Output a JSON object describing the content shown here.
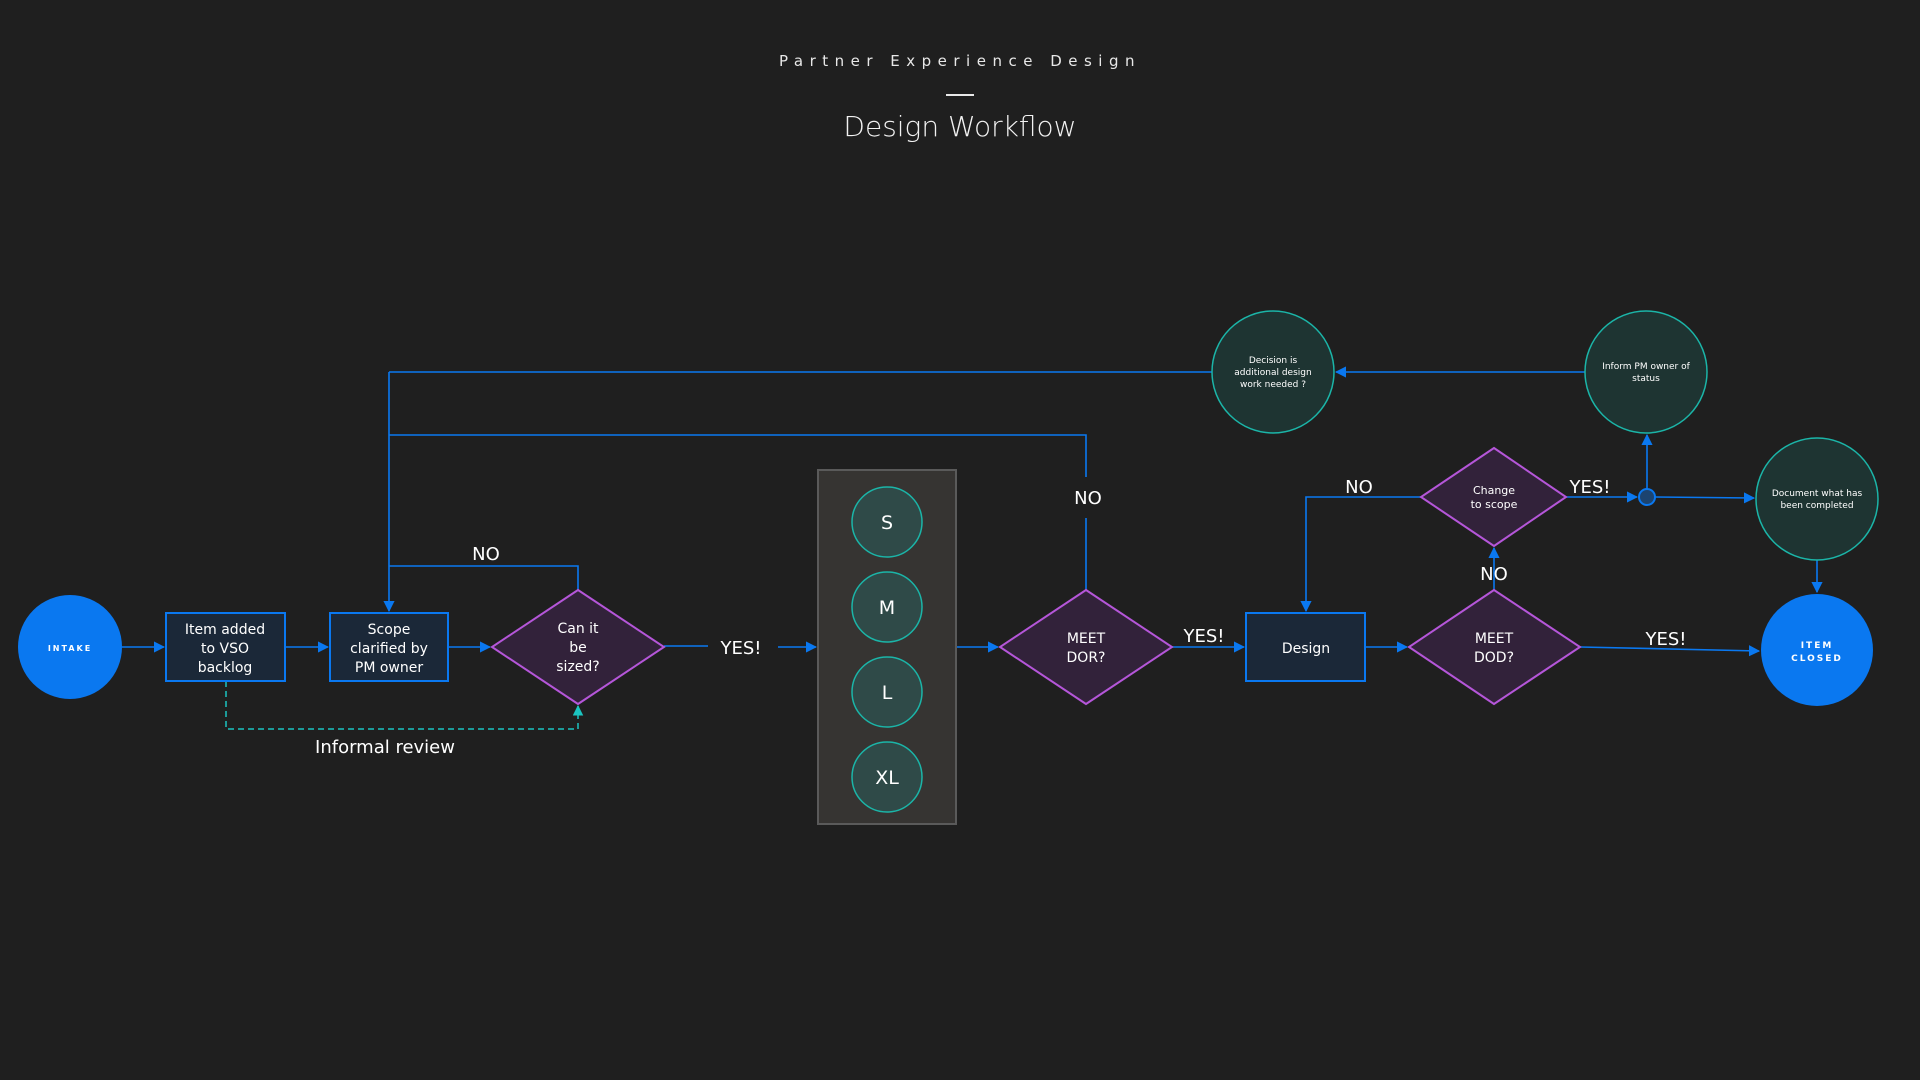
{
  "header": {
    "subtitle": "Partner Experience Design",
    "title": "Design Workflow"
  },
  "colors": {
    "background": "#1f1f1f",
    "connector": "#0a78f0",
    "terminal_fill": "#0a78f0",
    "process_fill": "#1b2838",
    "process_stroke": "#0a78f0",
    "decision_fill": "#32223a",
    "decision_stroke": "#b556d9",
    "action_fill": "#1e3432",
    "action_stroke": "#1bb5a8",
    "size_panel_fill": "#363432",
    "size_panel_stroke": "#5a5a5a",
    "size_circle_fill": "#2f4a48",
    "review_dashed": "#1bc4c0"
  },
  "nodes": {
    "intake": {
      "label": "INTAKE"
    },
    "item_added": {
      "lines": [
        "Item added",
        "to VSO",
        "backlog"
      ]
    },
    "scope_clarified": {
      "lines": [
        "Scope",
        "clarified by",
        "PM owner"
      ]
    },
    "can_it_be_sized": {
      "lines": [
        "Can it",
        "be",
        "sized?"
      ]
    },
    "sizes": [
      "S",
      "M",
      "L",
      "XL"
    ],
    "meet_dor": {
      "lines": [
        "MEET",
        "DOR?"
      ]
    },
    "design": {
      "label": "Design"
    },
    "meet_dod": {
      "lines": [
        "MEET",
        "DOD?"
      ]
    },
    "change_to_scope": {
      "lines": [
        "Change",
        "to scope"
      ]
    },
    "decision_additional": {
      "lines": [
        "Decision is",
        "additional design",
        "work needed ?"
      ]
    },
    "inform_pm": {
      "lines": [
        "Inform PM owner of",
        "status"
      ]
    },
    "document_completed": {
      "lines": [
        "Document what has",
        "been completed"
      ]
    },
    "item_closed": {
      "lines": [
        "ITEM",
        "CLOSED"
      ]
    }
  },
  "edge_labels": {
    "sized_no": "NO",
    "sized_yes": "YES!",
    "dor_no": "NO",
    "dor_yes": "YES!",
    "change_no": "NO",
    "change_yes": "YES!",
    "dod_no": "NO",
    "dod_yes": "YES!",
    "informal_review": "Informal review"
  }
}
